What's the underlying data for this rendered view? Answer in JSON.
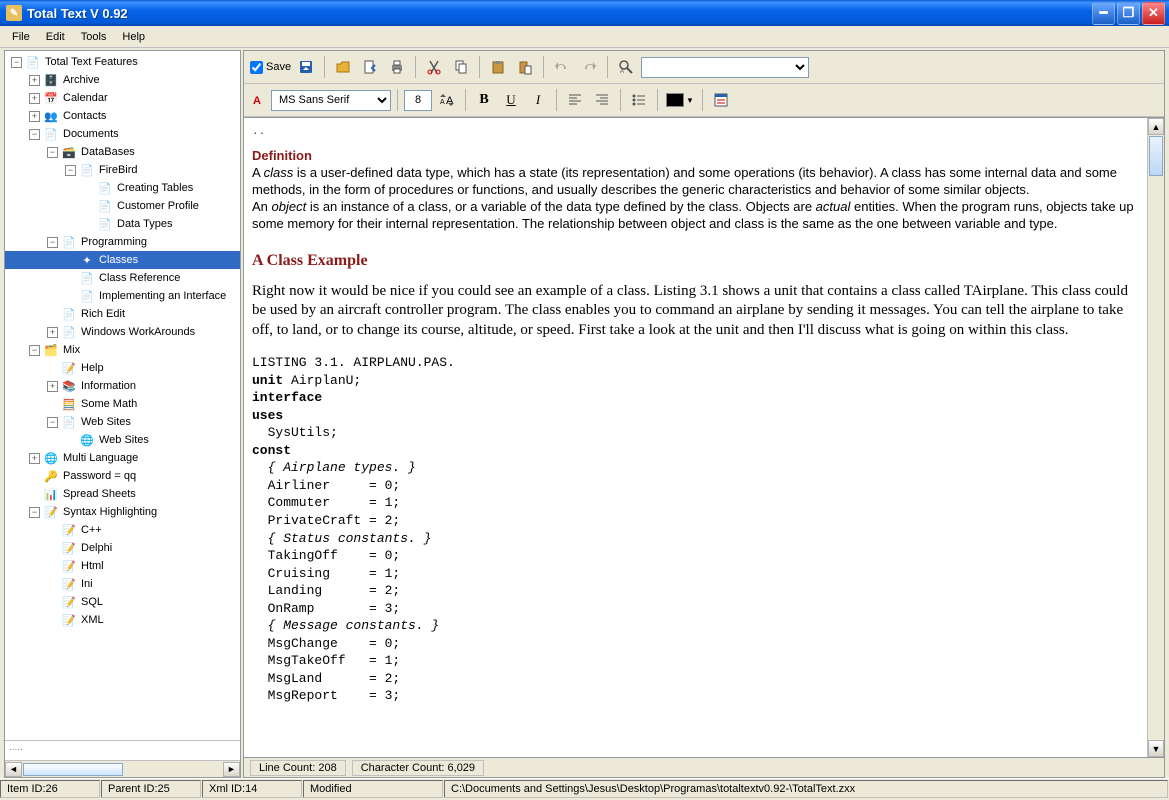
{
  "title": "Total Text V 0.92",
  "menu": [
    "File",
    "Edit",
    "Tools",
    "Help"
  ],
  "toolbar1": {
    "save_label": "Save"
  },
  "toolbar2": {
    "font": "MS Sans Serif",
    "size": "8"
  },
  "tree": [
    {
      "depth": 0,
      "exp": "-",
      "icon": "📄",
      "color": "#555",
      "label": "Total Text Features"
    },
    {
      "depth": 1,
      "exp": "+",
      "icon": "🗄️",
      "label": "Archive"
    },
    {
      "depth": 1,
      "exp": "+",
      "icon": "📅",
      "label": "Calendar"
    },
    {
      "depth": 1,
      "exp": "+",
      "icon": "👥",
      "label": "Contacts"
    },
    {
      "depth": 1,
      "exp": "-",
      "icon": "📄",
      "label": "Documents"
    },
    {
      "depth": 2,
      "exp": "-",
      "icon": "🗃️",
      "label": "DataBases"
    },
    {
      "depth": 3,
      "exp": "-",
      "icon": "📄",
      "label": "FireBird"
    },
    {
      "depth": 4,
      "exp": "",
      "icon": "📄",
      "label": "Creating Tables"
    },
    {
      "depth": 4,
      "exp": "",
      "icon": "📄",
      "label": "Customer Profile"
    },
    {
      "depth": 4,
      "exp": "",
      "icon": "📄",
      "label": "Data Types"
    },
    {
      "depth": 2,
      "exp": "-",
      "icon": "📄",
      "label": "Programming"
    },
    {
      "depth": 3,
      "exp": "",
      "icon": "✦",
      "label": "Classes",
      "selected": true
    },
    {
      "depth": 3,
      "exp": "",
      "icon": "📄",
      "label": "Class Reference"
    },
    {
      "depth": 3,
      "exp": "",
      "icon": "📄",
      "label": "Implementing an Interface"
    },
    {
      "depth": 2,
      "exp": "",
      "icon": "📄",
      "label": "Rich Edit"
    },
    {
      "depth": 2,
      "exp": "+",
      "icon": "📄",
      "label": "Windows WorkArounds"
    },
    {
      "depth": 1,
      "exp": "-",
      "icon": "🗂️",
      "label": "Mix"
    },
    {
      "depth": 2,
      "exp": "",
      "icon": "📝",
      "label": "Help"
    },
    {
      "depth": 2,
      "exp": "+",
      "icon": "📚",
      "label": "Information"
    },
    {
      "depth": 2,
      "exp": "",
      "icon": "🧮",
      "label": "Some Math"
    },
    {
      "depth": 2,
      "exp": "-",
      "icon": "📄",
      "label": "Web Sites"
    },
    {
      "depth": 3,
      "exp": "",
      "icon": "🌐",
      "label": "Web Sites"
    },
    {
      "depth": 1,
      "exp": "+",
      "icon": "🌐",
      "label": "Multi Language"
    },
    {
      "depth": 1,
      "exp": "",
      "icon": "🔑",
      "label": "Password = qq"
    },
    {
      "depth": 1,
      "exp": "",
      "icon": "📊",
      "label": "Spread Sheets"
    },
    {
      "depth": 1,
      "exp": "-",
      "icon": "📝",
      "label": "Syntax Highlighting"
    },
    {
      "depth": 2,
      "exp": "",
      "icon": "📝",
      "label": "C++"
    },
    {
      "depth": 2,
      "exp": "",
      "icon": "📝",
      "label": "Delphi"
    },
    {
      "depth": 2,
      "exp": "",
      "icon": "📝",
      "label": "Html"
    },
    {
      "depth": 2,
      "exp": "",
      "icon": "📝",
      "label": "Ini"
    },
    {
      "depth": 2,
      "exp": "",
      "icon": "📝",
      "label": "SQL"
    },
    {
      "depth": 2,
      "exp": "",
      "icon": "📝",
      "label": "XML"
    }
  ],
  "sidebar_footer": ".....",
  "doc": {
    "def_head": "Definition",
    "def_p1a": "A ",
    "def_p1b": "class",
    "def_p1c": " is a user-defined data type, which has a state (its representation) and some operations (its behavior). A class has some internal data and some methods, in the form of procedures or functions, and usually describes the generic characteristics and behavior of some similar objects.",
    "def_p2a": "An ",
    "def_p2b": "object",
    "def_p2c": " is an instance of a class, or a variable of the data type defined by the class. Objects are ",
    "def_p2d": "actual",
    "def_p2e": " entities. When the program runs, objects take up some memory for their internal representation. The relationship between object and class is the same as the one between variable and type.",
    "sec_head": "A Class Example",
    "sec_p": "Right now it would be nice if you could see an example of a class. Listing 3.1 shows a unit that contains a class called TAirplane. This class could be used by an aircraft controller program. The class enables you to command an airplane by sending it messages. You can tell the airplane to take off, to land, or to change its course, altitude, or speed. First take a look at the unit and then I'll discuss what is going on within this class.",
    "code_listing": "LISTING 3.1. AIRPLANU.PAS.",
    "code_lines": [
      {
        "t": "kw",
        "v": "unit "
      },
      {
        "t": "",
        "v": "AirplanU;"
      },
      "\n",
      {
        "t": "kw",
        "v": "interface"
      },
      "\n",
      {
        "t": "kw",
        "v": "uses"
      },
      "\n",
      {
        "t": "",
        "v": "  SysUtils;"
      },
      "\n",
      {
        "t": "kw",
        "v": "const"
      },
      "\n",
      {
        "t": "cm",
        "v": "  { Airplane types. }"
      },
      "\n",
      {
        "t": "",
        "v": "  Airliner     = 0;"
      },
      "\n",
      {
        "t": "",
        "v": "  Commuter     = 1;"
      },
      "\n",
      {
        "t": "",
        "v": "  PrivateCraft = 2;"
      },
      "\n",
      {
        "t": "cm",
        "v": "  { Status constants. }"
      },
      "\n",
      {
        "t": "",
        "v": "  TakingOff    = 0;"
      },
      "\n",
      {
        "t": "",
        "v": "  Cruising     = 1;"
      },
      "\n",
      {
        "t": "",
        "v": "  Landing      = 2;"
      },
      "\n",
      {
        "t": "",
        "v": "  OnRamp       = 3;"
      },
      "\n",
      {
        "t": "cm",
        "v": "  { Message constants. }"
      },
      "\n",
      {
        "t": "",
        "v": "  MsgChange    = 0;"
      },
      "\n",
      {
        "t": "",
        "v": "  MsgTakeOff   = 1;"
      },
      "\n",
      {
        "t": "",
        "v": "  MsgLand      = 2;"
      },
      "\n",
      {
        "t": "",
        "v": "  MsgReport    = 3;"
      }
    ]
  },
  "counts": {
    "line_label": "Line Count: ",
    "line_value": "208",
    "char_label": "Character Count: ",
    "char_value": "6,029"
  },
  "status": {
    "item_id_label": "Item ID: ",
    "item_id": "26",
    "parent_id_label": "Parent ID: ",
    "parent_id": "25",
    "xml_id_label": "Xml ID: ",
    "xml_id": "14",
    "modified": "Modified",
    "path": "C:\\Documents and Settings\\Jesus\\Desktop\\Programas\\totaltextv0.92-\\TotalText.zxx"
  }
}
